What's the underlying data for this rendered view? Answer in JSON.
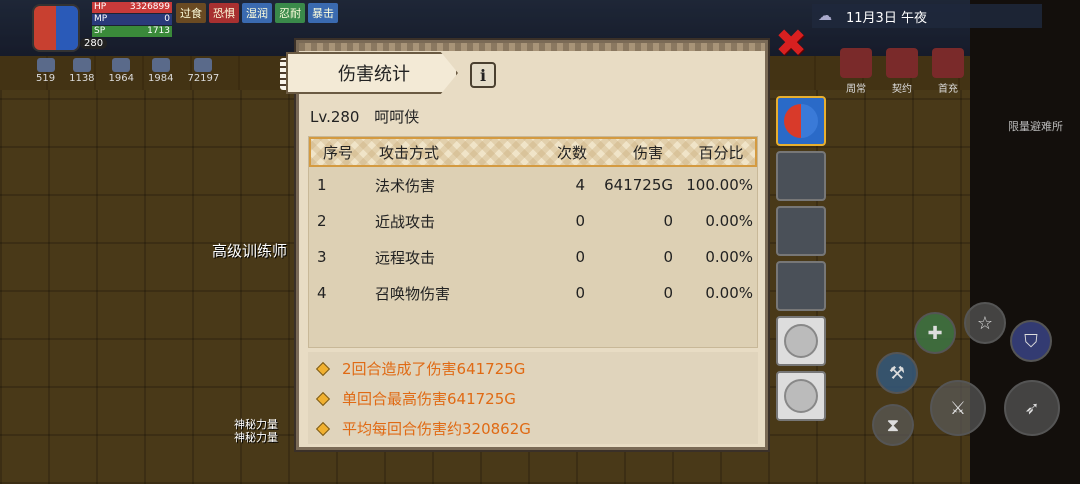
{
  "hud": {
    "hp_label": "HP",
    "hp_value": "3326899",
    "mp_label": "MP",
    "mp_value": "0",
    "sp_label": "SP",
    "sp_value": "1713",
    "level": "280",
    "tags": [
      "过食",
      "恐惧",
      "湿润",
      "忍耐",
      "暴击"
    ],
    "stats": [
      "519",
      "1138",
      "1964",
      "1984",
      "72197"
    ],
    "date": "11月3日  午夜",
    "right_icons": [
      "周常",
      "契约",
      "首充"
    ],
    "safe_room": "限量避难所",
    "npc_label": "高级训练师",
    "messages": [
      "神秘力量",
      "神秘力量"
    ]
  },
  "panel": {
    "title": "伤害统计",
    "info_icon": "i",
    "player_level": "Lv.280",
    "player_name": "呵呵侠",
    "columns": [
      "序号",
      "攻击方式",
      "次数",
      "伤害",
      "百分比"
    ],
    "rows": [
      {
        "idx": "1",
        "type": "法术伤害",
        "count": "4",
        "damage": "641725G",
        "pct": "100.00%"
      },
      {
        "idx": "2",
        "type": "近战攻击",
        "count": "0",
        "damage": "0",
        "pct": "0.00%"
      },
      {
        "idx": "3",
        "type": "远程攻击",
        "count": "0",
        "damage": "0",
        "pct": "0.00%"
      },
      {
        "idx": "4",
        "type": "召唤物伤害",
        "count": "0",
        "damage": "0",
        "pct": "0.00%"
      }
    ],
    "summary": [
      "2回合造成了伤害641725G",
      "单回合最高伤害641725G",
      "平均每回合伤害约320862G"
    ],
    "close": "✖"
  },
  "colors": {
    "panel_bg": "#e8dcc4",
    "header_border": "#d49a40",
    "summary_text": "#e06a14",
    "close_red": "#d82020"
  }
}
